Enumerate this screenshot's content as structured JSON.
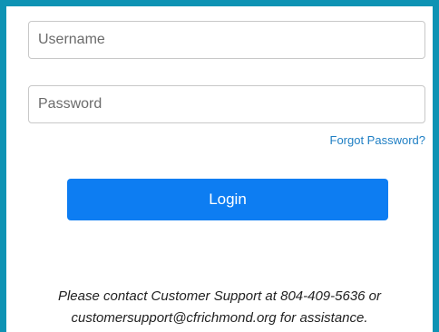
{
  "login_form": {
    "username_placeholder": "Username",
    "password_placeholder": "Password",
    "forgot_password_label": "Forgot Password?",
    "login_button_label": "Login"
  },
  "support_message": {
    "line1": "Please contact Customer Support at 804-409-5636 or",
    "line2": "customersupport@cfrichmond.org for assistance."
  },
  "colors": {
    "frame_border": "#0e93b4",
    "login_button": "#0d7df2",
    "forgot_link": "#1f7fc4"
  }
}
